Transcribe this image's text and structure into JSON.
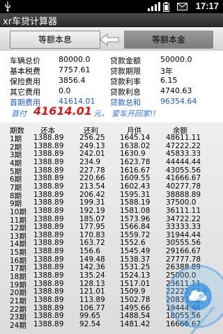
{
  "status_bar": {
    "time": "17:17",
    "icons": [
      "usb-icon",
      "signal-icon",
      "battery-icon",
      "mail-icon"
    ]
  },
  "app": {
    "title": "xr车贷计算器"
  },
  "tabs": {
    "left": "等额本息",
    "right": "等额本金",
    "swap_icon": "swap-back-icon"
  },
  "info": {
    "car_price_label": "车辆总价",
    "car_price": "80000.0",
    "loan_total_label": "贷款金额",
    "loan_total": "50000.0",
    "base_tax_label": "基本税费",
    "base_tax": "7757.61",
    "loan_term_label": "贷款期限",
    "loan_term": "3年",
    "insurance_label": "保险费用",
    "insurance": "3856.4",
    "loan_rate_label": "贷款利率",
    "loan_rate": "6.15",
    "other_fee_label": "其它费用",
    "other_fee": "0.0",
    "loan_interest_label": "贷款利息",
    "loan_interest": "4740.63",
    "first_fee_label": "首期费用",
    "first_fee": "41614.01",
    "loan_sum_label": "贷款总和",
    "loan_sum": "96354.64"
  },
  "first_payment": {
    "label": "首付",
    "value": "41614.01",
    "unit": "元，",
    "slogan": "爱车开回家!!"
  },
  "table": {
    "headers": [
      "期数",
      "还本",
      "还利",
      "月供",
      "余额"
    ],
    "rows": [
      [
        "1期",
        "1388.89",
        "256.25",
        "1645.14",
        "48611.11"
      ],
      [
        "2期",
        "1388.89",
        "249.13",
        "1638.02",
        "47222.22"
      ],
      [
        "3期",
        "1388.89",
        "242.01",
        "1630.9",
        "45833.33"
      ],
      [
        "4期",
        "1388.89",
        "234.9",
        "1623.78",
        "44444.44"
      ],
      [
        "5期",
        "1388.89",
        "227.78",
        "1616.67",
        "43055.56"
      ],
      [
        "6期",
        "1388.89",
        "220.66",
        "1609.55",
        "41666.67"
      ],
      [
        "7期",
        "1388.89",
        "213.54",
        "1602.43",
        "40277.78"
      ],
      [
        "8期",
        "1388.89",
        "206.42",
        "1595.31",
        "38888.89"
      ],
      [
        "9期",
        "1388.89",
        "199.31",
        "1588.19",
        "37500.0"
      ],
      [
        "10期",
        "1388.89",
        "192.19",
        "1581.08",
        "36111.11"
      ],
      [
        "11期",
        "1388.89",
        "185.07",
        "1573.96",
        "34722.22"
      ],
      [
        "12期",
        "1388.89",
        "177.95",
        "1566.84",
        "33333.33"
      ],
      [
        "13期",
        "1388.89",
        "170.83",
        "1559.72",
        "31944.44"
      ],
      [
        "14期",
        "1388.89",
        "163.72",
        "1552.6",
        "30555.56"
      ],
      [
        "15期",
        "1388.89",
        "156.6",
        "1545.49",
        "29166.67"
      ],
      [
        "16期",
        "1388.89",
        "149.48",
        "1538.37",
        "27777.78"
      ],
      [
        "17期",
        "1388.89",
        "142.36",
        "1531.25",
        "26388.89"
      ],
      [
        "18期",
        "1388.89",
        "135.24",
        "1524.13",
        "25000.0"
      ],
      [
        "19期",
        "1388.89",
        "128.13",
        "1517.01",
        "23611.11"
      ],
      [
        "20期",
        "1388.89",
        "121.01",
        "1509.9",
        "22222.22"
      ],
      [
        "21期",
        "1388.89",
        "113.89",
        "1502.78",
        "20833.33"
      ],
      [
        "22期",
        "1388.89",
        "106.77",
        "1495.66",
        "19444.44"
      ],
      [
        "23期",
        "1388.89",
        "99.65",
        "1488.54",
        "18055.56"
      ],
      [
        "24期",
        "1388.89",
        "92.54",
        "1481.42",
        "16666.67"
      ]
    ]
  },
  "watermark": {
    "text": "智汇云应用市场",
    "url_text": "www.hicloud.com"
  }
}
